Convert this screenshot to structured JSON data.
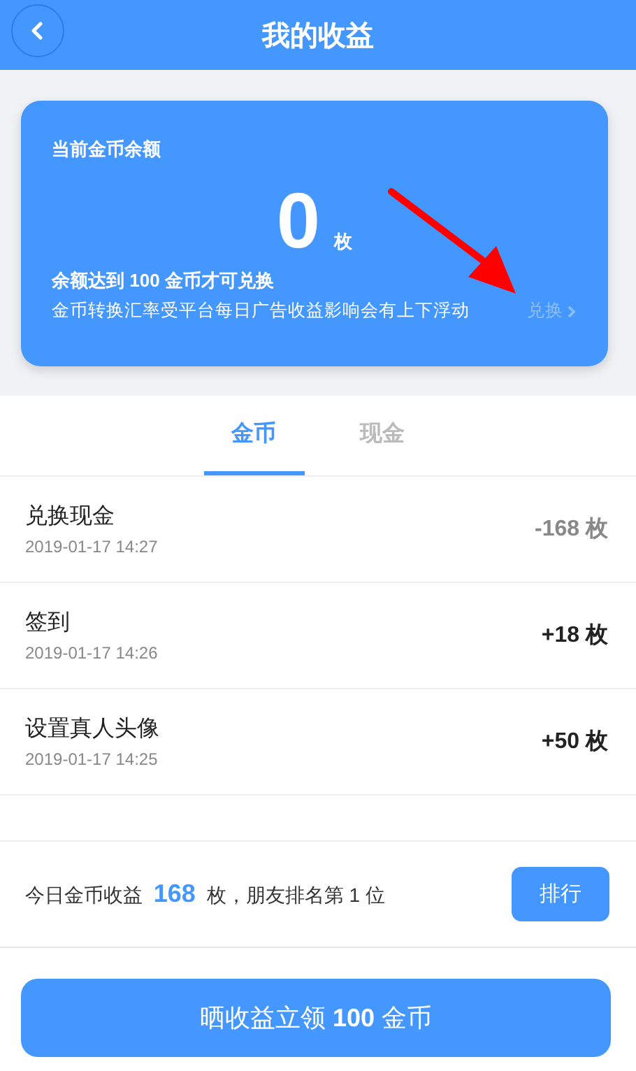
{
  "header": {
    "title": "我的收益"
  },
  "balance_card": {
    "label": "当前金币余额",
    "amount": "0",
    "unit": "枚",
    "notice": "余额达到 100 金币才可兑换",
    "note": "金币转换汇率受平台每日广告收益影响会有上下浮动",
    "link": "兑换",
    "link_disabled": true
  },
  "tabs": [
    {
      "label": "金币",
      "selected": true
    },
    {
      "label": "现金",
      "selected": false
    }
  ],
  "records": [
    {
      "title": "兑换现金",
      "time": "2019-01-17 14:27",
      "amount": "-168 枚",
      "kind": "debit"
    },
    {
      "title": "签到",
      "time": "2019-01-17 14:26",
      "amount": "+18 枚",
      "kind": "credit"
    },
    {
      "title": "设置真人头像",
      "time": "2019-01-17 14:25",
      "amount": "+50 枚",
      "kind": "credit"
    }
  ],
  "summary": {
    "text": "今日金币收益 **168** 枚，朋友排名第 1 位",
    "button": "排行"
  },
  "share_button": "晒收益立领 **100** 金币"
}
